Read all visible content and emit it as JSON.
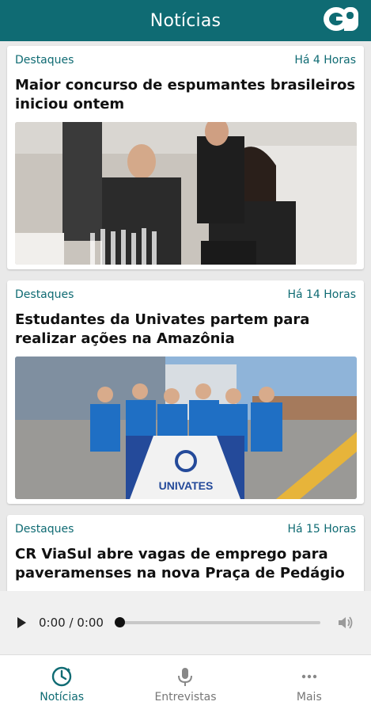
{
  "header": {
    "title": "Notícias",
    "logo": "GP"
  },
  "articles": [
    {
      "category": "Destaques",
      "time": "Há 4 Horas",
      "title": "Maior concurso de espumantes brasileiros iniciou ontem",
      "image_label": ""
    },
    {
      "category": "Destaques",
      "time": "Há 14 Horas",
      "title": "Estudantes da Univates partem para realizar ações na Amazônia",
      "image_label": "UNIVATES"
    },
    {
      "category": "Destaques",
      "time": "Há 15 Horas",
      "title": "CR ViaSul abre vagas de emprego para paveramenses na nova Praça de Pedágio",
      "image_label": ""
    }
  ],
  "player": {
    "time": "0:00 / 0:00",
    "progress": 0
  },
  "nav": [
    {
      "label": "Notícias",
      "icon": "clock-icon",
      "active": true
    },
    {
      "label": "Entrevistas",
      "icon": "microphone-icon",
      "active": false
    },
    {
      "label": "Mais",
      "icon": "more-icon",
      "active": false
    }
  ],
  "colors": {
    "primary": "#0f6b73",
    "accent": "#119a8f"
  }
}
